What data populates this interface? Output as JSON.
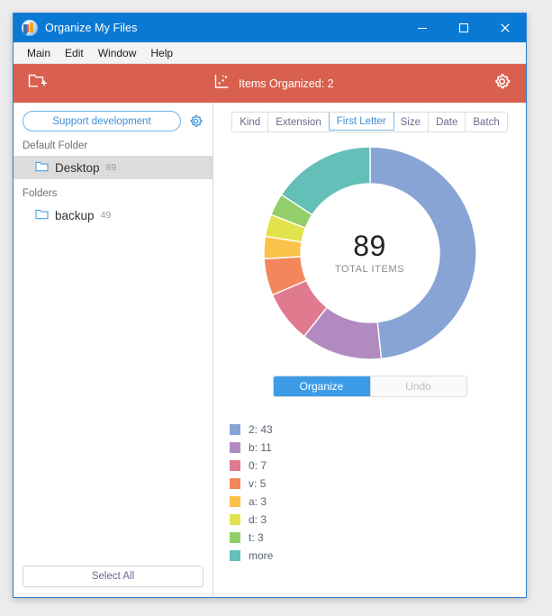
{
  "window": {
    "title": "Organize My Files",
    "app_icon": "app-logo-icon",
    "minimize_label": "minimize",
    "maximize_label": "maximize",
    "close_label": "close"
  },
  "menubar": {
    "items": [
      {
        "label": "Main"
      },
      {
        "label": "Edit"
      },
      {
        "label": "Window"
      },
      {
        "label": "Help"
      }
    ]
  },
  "toolbar": {
    "add_folder_icon": "folder-add-icon",
    "stats_icon": "chart-icon",
    "status_text": "Items Organized: 2",
    "settings_icon": "gear-icon",
    "background_color": "#d9604f"
  },
  "sidebar": {
    "support_label": "Support development",
    "support_settings_icon": "gear-icon",
    "groups": [
      {
        "label": "Default Folder",
        "items": [
          {
            "name": "Desktop",
            "count": "89",
            "selected": true
          }
        ]
      },
      {
        "label": "Folders",
        "items": [
          {
            "name": "backup",
            "count": "49",
            "selected": false
          }
        ]
      }
    ],
    "select_all_label": "Select All"
  },
  "main": {
    "tabs": [
      {
        "label": "Kind",
        "active": false
      },
      {
        "label": "Extension",
        "active": false
      },
      {
        "label": "First Letter",
        "active": true
      },
      {
        "label": "Size",
        "active": false
      },
      {
        "label": "Date",
        "active": false
      },
      {
        "label": "Batch",
        "active": false
      }
    ],
    "center_total": "89",
    "center_caption": "TOTAL ITEMS",
    "organize_label": "Organize",
    "undo_label": "Undo",
    "accent_color": "#3c9ce8"
  },
  "chart_data": {
    "type": "pie",
    "title": "",
    "subtitle": "",
    "xlabel": "",
    "ylabel": "",
    "legend_position": "bottom-left",
    "donut": true,
    "total": 89,
    "total_caption": "TOTAL ITEMS",
    "start_angle_deg": 0,
    "direction": "clockwise",
    "categories": [
      "2",
      "b",
      "0",
      "v",
      "a",
      "d",
      "t",
      "more"
    ],
    "values": [
      43,
      11,
      7,
      5,
      3,
      3,
      3,
      14
    ],
    "colors": [
      "#87a4d4",
      "#b18ac0",
      "#e07b8f",
      "#f4865c",
      "#fbc249",
      "#e2e34c",
      "#92ce6a",
      "#64bfb9"
    ],
    "legend": [
      {
        "label": "2: 43",
        "color": "#87a4d4"
      },
      {
        "label": "b: 11",
        "color": "#b18ac0"
      },
      {
        "label": "0: 7",
        "color": "#e07b8f"
      },
      {
        "label": "v: 5",
        "color": "#f4865c"
      },
      {
        "label": "a: 3",
        "color": "#fbc249"
      },
      {
        "label": "d: 3",
        "color": "#e2e34c"
      },
      {
        "label": "t: 3",
        "color": "#92ce6a"
      },
      {
        "label": "more",
        "color": "#64bfb9"
      }
    ]
  }
}
